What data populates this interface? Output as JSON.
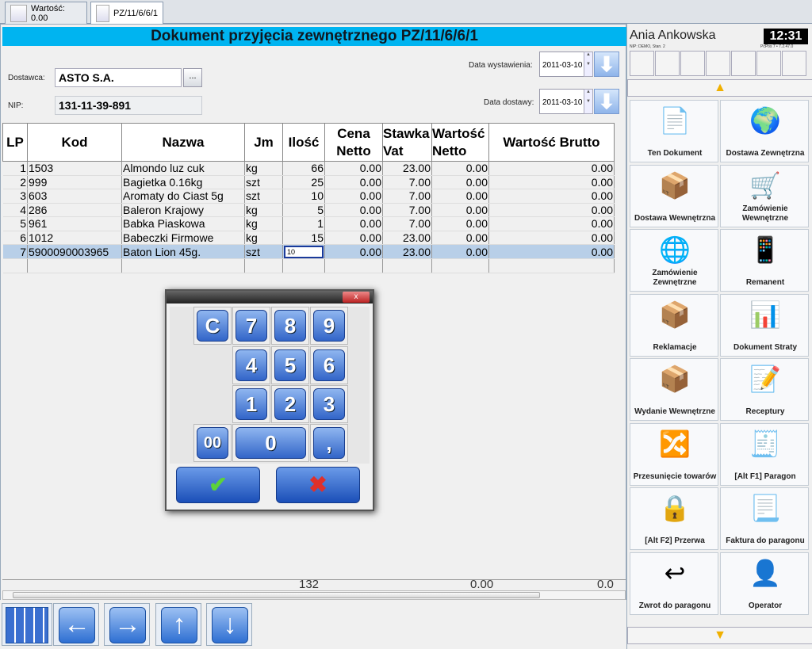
{
  "tabs": [
    {
      "label": "Wartość: 0.00"
    },
    {
      "label": "PZ/11/6/6/1"
    }
  ],
  "header": {
    "title": "Dokument przyjęcia zewnętrznego PZ/11/6/6/1"
  },
  "form": {
    "supplier_label": "Dostawca:",
    "supplier_value": "ASTO S.A.",
    "browse_label": "...",
    "nip_label": "NIP:",
    "nip_value": "131-11-39-891",
    "issue_label": "Data wystawienia:",
    "issue_value": "2011-03-10",
    "delivery_label": "Data dostawy:",
    "delivery_value": "2011-03-10"
  },
  "table": {
    "headers": [
      "LP",
      "Kod",
      "Nazwa",
      "Jm",
      "Ilość",
      "Cena Netto",
      "Stawka Vat",
      "Wartość Netto",
      "Wartość Brutto"
    ],
    "rows": [
      [
        "1",
        "1503",
        "Almondo luz cuk",
        "kg",
        "66",
        "0.00",
        "23.00",
        "0.00",
        "0.00"
      ],
      [
        "2",
        "999",
        "Bagietka 0.16kg",
        "szt",
        "25",
        "0.00",
        "7.00",
        "0.00",
        "0.00"
      ],
      [
        "3",
        "603",
        "Aromaty do Ciast 5g",
        "szt",
        "10",
        "0.00",
        "7.00",
        "0.00",
        "0.00"
      ],
      [
        "4",
        "286",
        "Baleron Krajowy",
        "kg",
        "5",
        "0.00",
        "7.00",
        "0.00",
        "0.00"
      ],
      [
        "5",
        "961",
        "Babka Piaskowa",
        "kg",
        "1",
        "0.00",
        "7.00",
        "0.00",
        "0.00"
      ],
      [
        "6",
        "1012",
        "Babeczki Firmowe",
        "kg",
        "15",
        "0.00",
        "23.00",
        "0.00",
        "0.00"
      ],
      [
        "7",
        "5900090003965",
        "Baton Lion 45g.",
        "szt",
        "10",
        "0.00",
        "23.00",
        "0.00",
        "0.00"
      ]
    ],
    "totals": {
      "qty": "132",
      "netto": "0.00",
      "brutto": "0.0"
    }
  },
  "keypad": {
    "keys": [
      "C",
      "7",
      "8",
      "9",
      "4",
      "5",
      "6",
      "1",
      "2",
      "3",
      "00",
      "0",
      ","
    ],
    "ok": "✔",
    "cancel": "✖",
    "close": "x"
  },
  "nav": {
    "keypad_icon": "keypad-icon",
    "left": "←",
    "right": "→",
    "up": "↑",
    "down": "↓"
  },
  "side": {
    "user": "Ania Ankowska",
    "clock": "12:31",
    "nip_small": "NIP: DEMO, Stan. 2",
    "version_small": "PcPos 7 • 7.2.47.0",
    "tiles": [
      {
        "label": "Ten Dokument",
        "icon": "document-icon"
      },
      {
        "label": "Dostawa Zewnętrzna",
        "icon": "external-delivery-icon"
      },
      {
        "label": "Dostawa Wewnętrzna",
        "icon": "internal-delivery-icon"
      },
      {
        "label": "Zamówienie Wewnętrzne",
        "icon": "internal-order-icon"
      },
      {
        "label": "Zamówienie Zewnętrzne",
        "icon": "external-order-icon"
      },
      {
        "label": "Remanent",
        "icon": "inventory-icon"
      },
      {
        "label": "Reklamacje",
        "icon": "complaint-icon"
      },
      {
        "label": "Dokument Straty",
        "icon": "loss-document-icon"
      },
      {
        "label": "Wydanie Wewnętrzne",
        "icon": "internal-release-icon"
      },
      {
        "label": "Receptury",
        "icon": "recipe-icon"
      },
      {
        "label": "Przesunięcie towarów",
        "icon": "transfer-icon"
      },
      {
        "label": "[Alt F1] Paragon",
        "icon": "receipt-icon"
      },
      {
        "label": "[Alt F2] Przerwa",
        "icon": "lock-icon"
      },
      {
        "label": "Faktura do paragonu",
        "icon": "invoice-icon"
      },
      {
        "label": "Zwrot do paragonu",
        "icon": "return-icon"
      },
      {
        "label": "Operator",
        "icon": "operator-icon"
      }
    ]
  }
}
